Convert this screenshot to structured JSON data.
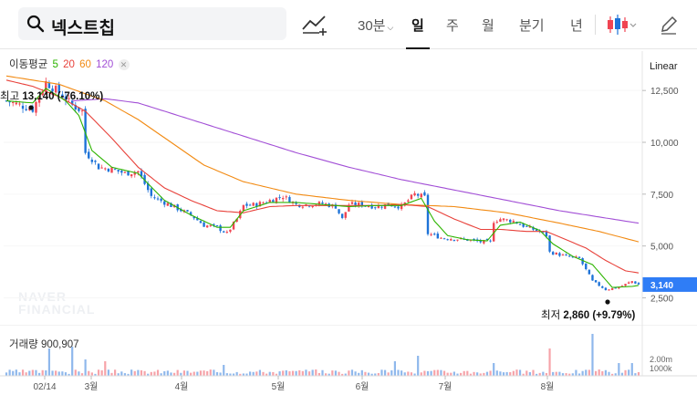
{
  "header": {
    "title": "넥스트칩",
    "search_icon": "search-icon",
    "compare_icon": "compare-icon",
    "periods": [
      {
        "label": "30분",
        "has_dropdown": true,
        "active": false
      },
      {
        "label": "일",
        "active": true
      },
      {
        "label": "주",
        "active": false
      },
      {
        "label": "월",
        "active": false
      },
      {
        "label": "분기",
        "active": false
      },
      {
        "label": "년",
        "active": false
      }
    ],
    "chart_type_icon": "candlestick-icon",
    "draw_icon": "pencil-icon"
  },
  "moving_average": {
    "label": "이동평균",
    "periods": [
      {
        "label": "5",
        "color": "#2db400"
      },
      {
        "label": "20",
        "color": "#e8413a"
      },
      {
        "label": "60",
        "color": "#f28a12"
      },
      {
        "label": "120",
        "color": "#a24fd6"
      }
    ],
    "close_icon": "close-icon"
  },
  "scale": {
    "label": "Linear"
  },
  "colors": {
    "up": "#f04452",
    "down": "#1e73d8",
    "price_tag": "#2f7df6"
  },
  "volume_panel": {
    "label": "거래량",
    "value": "900,907"
  },
  "watermark": [
    "NAVER",
    "FINANCIAL"
  ],
  "chart_data": {
    "type": "candlestick",
    "y_axis": {
      "ticks": [
        2500,
        5000,
        7500,
        10000,
        12500
      ],
      "tick_labels": [
        "2,500",
        "5,000",
        "7,500",
        "10,000",
        "12,500"
      ],
      "range": [
        1200,
        14400
      ]
    },
    "x_axis": {
      "tick_labels": [
        "02/14",
        "3월",
        "4월",
        "5월",
        "6월",
        "7월",
        "8월"
      ]
    },
    "current_price": {
      "value": 3140,
      "label": "3,140"
    },
    "high": {
      "label": "최고",
      "value": "13,140",
      "change": "(-76.10%)"
    },
    "low": {
      "label": "최저",
      "value": "2,860",
      "change": "(+9.79%)"
    },
    "volume_axis": {
      "tick_labels": [
        "2.00m",
        "1000k"
      ]
    },
    "series_anchors": {
      "close": [
        [
          0,
          12000
        ],
        [
          4,
          11800
        ],
        [
          8,
          11600
        ],
        [
          12,
          12900
        ],
        [
          16,
          12400
        ],
        [
          20,
          11800
        ],
        [
          23,
          11500
        ],
        [
          24,
          9500
        ],
        [
          26,
          9200
        ],
        [
          28,
          8800
        ],
        [
          32,
          8700
        ],
        [
          36,
          8500
        ],
        [
          40,
          8600
        ],
        [
          44,
          7400
        ],
        [
          48,
          7100
        ],
        [
          52,
          6800
        ],
        [
          56,
          6500
        ],
        [
          60,
          6000
        ],
        [
          64,
          5900
        ],
        [
          67,
          5600
        ],
        [
          70,
          6300
        ],
        [
          72,
          6950
        ],
        [
          76,
          7000
        ],
        [
          80,
          7200
        ],
        [
          84,
          7400
        ],
        [
          88,
          7000
        ],
        [
          92,
          7000
        ],
        [
          96,
          7050
        ],
        [
          100,
          6900
        ],
        [
          102,
          6300
        ],
        [
          104,
          7000
        ],
        [
          108,
          7000
        ],
        [
          112,
          6900
        ],
        [
          116,
          7000
        ],
        [
          120,
          6900
        ],
        [
          124,
          7500
        ],
        [
          127,
          7350
        ],
        [
          128,
          5600
        ],
        [
          132,
          5400
        ],
        [
          136,
          5350
        ],
        [
          140,
          5300
        ],
        [
          144,
          5200
        ],
        [
          147,
          5200
        ],
        [
          148,
          6200
        ],
        [
          150,
          6300
        ],
        [
          154,
          6200
        ],
        [
          158,
          5900
        ],
        [
          162,
          5700
        ],
        [
          164,
          5500
        ],
        [
          165,
          4700
        ],
        [
          170,
          4500
        ],
        [
          174,
          4400
        ],
        [
          178,
          3300
        ],
        [
          182,
          2900
        ],
        [
          186,
          3000
        ],
        [
          190,
          3300
        ],
        [
          192,
          3140
        ]
      ],
      "ma5": [
        [
          0,
          12000
        ],
        [
          8,
          11900
        ],
        [
          12,
          12600
        ],
        [
          18,
          12000
        ],
        [
          22,
          11300
        ],
        [
          26,
          9600
        ],
        [
          32,
          8800
        ],
        [
          40,
          8500
        ],
        [
          48,
          7200
        ],
        [
          56,
          6500
        ],
        [
          64,
          5900
        ],
        [
          68,
          5900
        ],
        [
          72,
          6700
        ],
        [
          80,
          7100
        ],
        [
          88,
          7100
        ],
        [
          96,
          7000
        ],
        [
          104,
          6900
        ],
        [
          112,
          6950
        ],
        [
          120,
          6950
        ],
        [
          126,
          7300
        ],
        [
          130,
          6200
        ],
        [
          134,
          5500
        ],
        [
          140,
          5300
        ],
        [
          146,
          5250
        ],
        [
          150,
          6000
        ],
        [
          156,
          6150
        ],
        [
          162,
          5750
        ],
        [
          166,
          5100
        ],
        [
          172,
          4500
        ],
        [
          178,
          4100
        ],
        [
          184,
          3000
        ],
        [
          190,
          3050
        ],
        [
          192,
          3100
        ]
      ],
      "ma20": [
        [
          0,
          13000
        ],
        [
          8,
          12700
        ],
        [
          16,
          12200
        ],
        [
          24,
          11500
        ],
        [
          32,
          10200
        ],
        [
          40,
          8800
        ],
        [
          48,
          7800
        ],
        [
          56,
          7200
        ],
        [
          64,
          6700
        ],
        [
          72,
          6600
        ],
        [
          80,
          6900
        ],
        [
          88,
          6950
        ],
        [
          96,
          6950
        ],
        [
          104,
          6950
        ],
        [
          112,
          6950
        ],
        [
          120,
          7000
        ],
        [
          128,
          6900
        ],
        [
          136,
          6300
        ],
        [
          144,
          5800
        ],
        [
          150,
          5800
        ],
        [
          158,
          5700
        ],
        [
          164,
          5700
        ],
        [
          170,
          5300
        ],
        [
          176,
          4900
        ],
        [
          182,
          4300
        ],
        [
          188,
          3800
        ],
        [
          192,
          3700
        ]
      ],
      "ma60": [
        [
          0,
          13200
        ],
        [
          16,
          12800
        ],
        [
          30,
          12000
        ],
        [
          40,
          11100
        ],
        [
          50,
          10000
        ],
        [
          60,
          8900
        ],
        [
          72,
          8100
        ],
        [
          88,
          7500
        ],
        [
          104,
          7200
        ],
        [
          120,
          7000
        ],
        [
          136,
          6900
        ],
        [
          152,
          6600
        ],
        [
          168,
          6100
        ],
        [
          180,
          5700
        ],
        [
          192,
          5200
        ]
      ],
      "ma120": [
        [
          20,
          12000
        ],
        [
          30,
          12100
        ],
        [
          40,
          11900
        ],
        [
          56,
          11100
        ],
        [
          72,
          10300
        ],
        [
          88,
          9500
        ],
        [
          104,
          8800
        ],
        [
          120,
          8200
        ],
        [
          136,
          7700
        ],
        [
          152,
          7200
        ],
        [
          168,
          6700
        ],
        [
          184,
          6300
        ],
        [
          192,
          6100
        ]
      ]
    }
  }
}
